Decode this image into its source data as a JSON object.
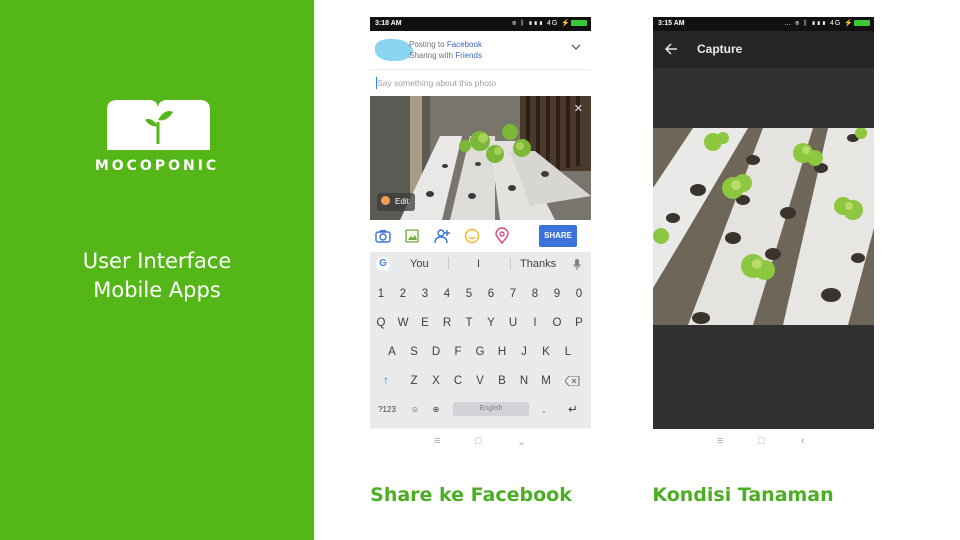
{
  "brand": {
    "name": "MOCOPONIC",
    "subtitle_line1": "User Interface",
    "subtitle_line2": "Mobile Apps",
    "panel_color": "#55b618"
  },
  "phone_share": {
    "status_time": "3:18 AM",
    "status_network": "4G",
    "posting_to_prefix": "Posting to",
    "posting_to_target": "Facebook",
    "sharing_with_prefix": "Sharing with",
    "sharing_with_target": "Friends",
    "caption_placeholder": "Say something about this photo",
    "edit_label": "Edit",
    "share_button": "SHARE",
    "action_icons": [
      "camera-icon",
      "gallery-icon",
      "tag-friends-icon",
      "feeling-icon",
      "location-icon"
    ],
    "suggestions": [
      "You",
      "I",
      "Thanks"
    ],
    "row_numbers": [
      "1",
      "2",
      "3",
      "4",
      "5",
      "6",
      "7",
      "8",
      "9",
      "0"
    ],
    "row_top": [
      "Q",
      "W",
      "E",
      "R",
      "T",
      "Y",
      "U",
      "I",
      "O",
      "P"
    ],
    "row_mid": [
      "A",
      "S",
      "D",
      "F",
      "G",
      "H",
      "J",
      "K",
      "L"
    ],
    "row_bottom": [
      "Z",
      "X",
      "C",
      "V",
      "B",
      "N",
      "M"
    ],
    "key_symbols": "?123",
    "space_label": "English",
    "period_key": "."
  },
  "phone_capture": {
    "status_time": "3:15 AM",
    "status_network": "4G",
    "title": "Capture"
  },
  "captions": {
    "share": "Share ke Facebook",
    "capture": "Kondisi Tanaman"
  },
  "colors": {
    "accent_green": "#4cae22",
    "facebook_blue": "#3a74d8"
  }
}
